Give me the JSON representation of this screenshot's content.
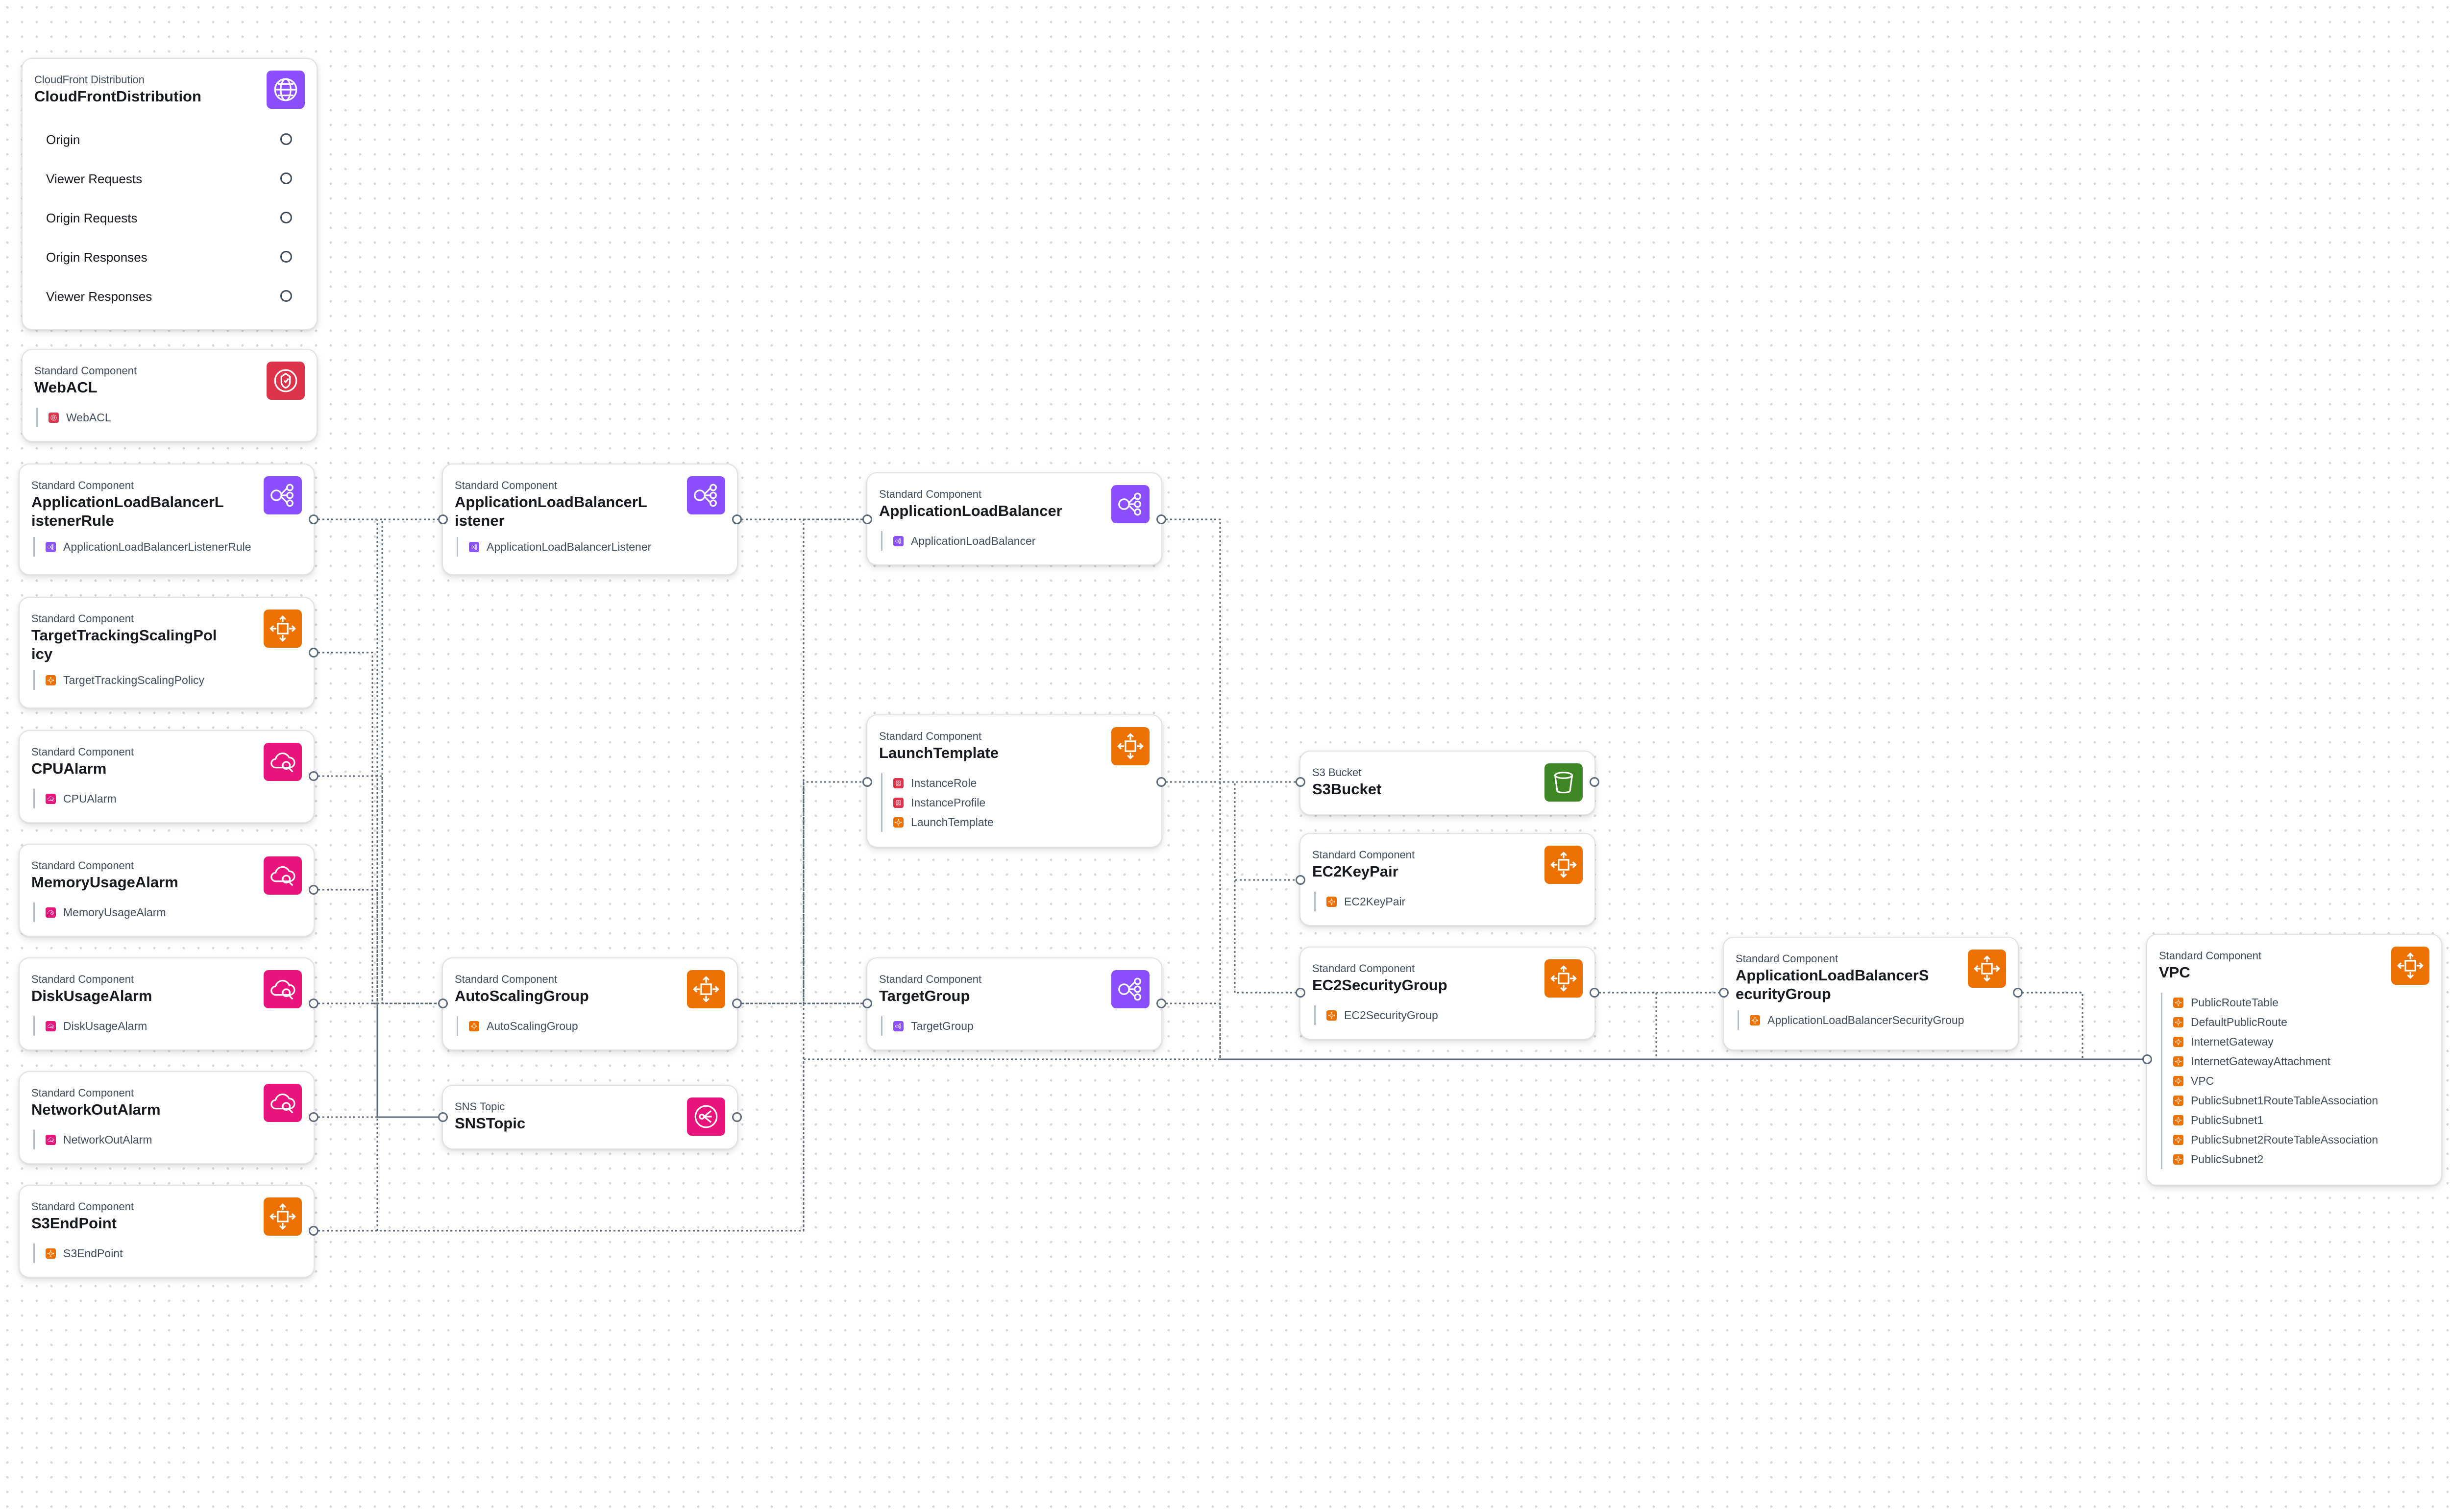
{
  "colors": {
    "purple": "#8c4fff",
    "orange": "#ed7100",
    "pink": "#e7157b",
    "red": "#dd344c",
    "green": "#3f8624",
    "wire": "#5f6b7a"
  },
  "cloudfront": {
    "type": "CloudFront Distribution",
    "title": "CloudFrontDistribution",
    "icon": "cloudfront-icon",
    "rows": [
      "Origin",
      "Viewer Requests",
      "Origin Requests",
      "Origin Responses",
      "Viewer Responses"
    ]
  },
  "nodes": [
    {
      "id": "webacl",
      "type": "Standard Component",
      "title": "WebACL",
      "icon": "waf-icon",
      "color": "red",
      "children": [
        {
          "label": "WebACL",
          "color": "red",
          "icon": "waf-icon"
        }
      ]
    },
    {
      "id": "listener-rule",
      "type": "Standard Component",
      "title": "ApplicationLoadBalancerL\nistenerRule",
      "icon": "load-balancer-icon",
      "color": "purple",
      "children": [
        {
          "label": "ApplicationLoadBalancerListenerRule",
          "color": "purple",
          "icon": "load-balancer-icon"
        }
      ]
    },
    {
      "id": "scaling-policy",
      "type": "Standard Component",
      "title": "TargetTrackingScalingPol\nicy",
      "icon": "autoscaling-icon",
      "color": "orange",
      "children": [
        {
          "label": "TargetTrackingScalingPolicy",
          "color": "orange",
          "icon": "autoscaling-icon"
        }
      ]
    },
    {
      "id": "cpu-alarm",
      "type": "Standard Component",
      "title": "CPUAlarm",
      "icon": "cloudwatch-alarm-icon",
      "color": "pink",
      "children": [
        {
          "label": "CPUAlarm",
          "color": "pink",
          "icon": "cloudwatch-alarm-icon"
        }
      ]
    },
    {
      "id": "memory-alarm",
      "type": "Standard Component",
      "title": "MemoryUsageAlarm",
      "icon": "cloudwatch-alarm-icon",
      "color": "pink",
      "children": [
        {
          "label": "MemoryUsageAlarm",
          "color": "pink",
          "icon": "cloudwatch-alarm-icon"
        }
      ]
    },
    {
      "id": "disk-alarm",
      "type": "Standard Component",
      "title": "DiskUsageAlarm",
      "icon": "cloudwatch-alarm-icon",
      "color": "pink",
      "children": [
        {
          "label": "DiskUsageAlarm",
          "color": "pink",
          "icon": "cloudwatch-alarm-icon"
        }
      ]
    },
    {
      "id": "network-alarm",
      "type": "Standard Component",
      "title": "NetworkOutAlarm",
      "icon": "cloudwatch-alarm-icon",
      "color": "pink",
      "children": [
        {
          "label": "NetworkOutAlarm",
          "color": "pink",
          "icon": "cloudwatch-alarm-icon"
        }
      ]
    },
    {
      "id": "s3-endpoint",
      "type": "Standard Component",
      "title": "S3EndPoint",
      "icon": "autoscaling-icon",
      "color": "orange",
      "children": [
        {
          "label": "S3EndPoint",
          "color": "orange",
          "icon": "autoscaling-icon"
        }
      ]
    },
    {
      "id": "listener",
      "type": "Standard Component",
      "title": "ApplicationLoadBalancerL\nistener",
      "icon": "load-balancer-icon",
      "color": "purple",
      "children": [
        {
          "label": "ApplicationLoadBalancerListener",
          "color": "purple",
          "icon": "load-balancer-icon"
        }
      ]
    },
    {
      "id": "asg",
      "type": "Standard Component",
      "title": "AutoScalingGroup",
      "icon": "autoscaling-icon",
      "color": "orange",
      "children": [
        {
          "label": "AutoScalingGroup",
          "color": "orange",
          "icon": "autoscaling-icon"
        }
      ]
    },
    {
      "id": "sns",
      "type": "SNS Topic",
      "title": "SNSTopic",
      "icon": "sns-topic-icon",
      "color": "pink",
      "children": []
    },
    {
      "id": "alb",
      "type": "Standard Component",
      "title": "ApplicationLoadBalancer",
      "icon": "load-balancer-icon",
      "color": "purple",
      "children": [
        {
          "label": "ApplicationLoadBalancer",
          "color": "purple",
          "icon": "load-balancer-icon"
        }
      ]
    },
    {
      "id": "launch-template",
      "type": "Standard Component",
      "title": "LaunchTemplate",
      "icon": "autoscaling-icon",
      "color": "orange",
      "children": [
        {
          "label": "InstanceRole",
          "color": "red",
          "icon": "iam-icon"
        },
        {
          "label": "InstanceProfile",
          "color": "red",
          "icon": "iam-icon"
        },
        {
          "label": "LaunchTemplate",
          "color": "orange",
          "icon": "autoscaling-icon"
        }
      ]
    },
    {
      "id": "target-group",
      "type": "Standard Component",
      "title": "TargetGroup",
      "icon": "load-balancer-icon",
      "color": "purple",
      "children": [
        {
          "label": "TargetGroup",
          "color": "purple",
          "icon": "load-balancer-icon"
        }
      ]
    },
    {
      "id": "s3-bucket",
      "type": "S3 Bucket",
      "title": "S3Bucket",
      "icon": "s3-bucket-icon",
      "color": "green",
      "children": []
    },
    {
      "id": "keypair",
      "type": "Standard Component",
      "title": "EC2KeyPair",
      "icon": "autoscaling-icon",
      "color": "orange",
      "children": [
        {
          "label": "EC2KeyPair",
          "color": "orange",
          "icon": "autoscaling-icon"
        }
      ]
    },
    {
      "id": "ec2-sg",
      "type": "Standard Component",
      "title": "EC2SecurityGroup",
      "icon": "autoscaling-icon",
      "color": "orange",
      "children": [
        {
          "label": "EC2SecurityGroup",
          "color": "orange",
          "icon": "autoscaling-icon"
        }
      ]
    },
    {
      "id": "alb-sg",
      "type": "Standard Component",
      "title": "ApplicationLoadBalancerS\necurityGroup",
      "icon": "autoscaling-icon",
      "color": "orange",
      "children": [
        {
          "label": "ApplicationLoadBalancerSecurityGroup",
          "color": "orange",
          "icon": "autoscaling-icon"
        }
      ]
    },
    {
      "id": "vpc",
      "type": "Standard Component",
      "title": "VPC",
      "icon": "autoscaling-icon",
      "color": "orange",
      "children": [
        {
          "label": "PublicRouteTable",
          "color": "orange",
          "icon": "autoscaling-icon"
        },
        {
          "label": "DefaultPublicRoute",
          "color": "orange",
          "icon": "autoscaling-icon"
        },
        {
          "label": "InternetGateway",
          "color": "orange",
          "icon": "autoscaling-icon"
        },
        {
          "label": "InternetGatewayAttachment",
          "color": "orange",
          "icon": "autoscaling-icon"
        },
        {
          "label": "VPC",
          "color": "orange",
          "icon": "autoscaling-icon"
        },
        {
          "label": "PublicSubnet1RouteTableAssociation",
          "color": "orange",
          "icon": "autoscaling-icon"
        },
        {
          "label": "PublicSubnet1",
          "color": "orange",
          "icon": "autoscaling-icon"
        },
        {
          "label": "PublicSubnet2RouteTableAssociation",
          "color": "orange",
          "icon": "autoscaling-icon"
        },
        {
          "label": "PublicSubnet2",
          "color": "orange",
          "icon": "autoscaling-icon"
        }
      ]
    }
  ],
  "edges": [
    {
      "from": "listener-rule",
      "to": "listener"
    },
    {
      "from": "listener",
      "to": "alb"
    },
    {
      "from": "alb",
      "to": "vpc"
    },
    {
      "from": "scaling-policy",
      "to": "asg"
    },
    {
      "from": "cpu-alarm",
      "to": "sns"
    },
    {
      "from": "memory-alarm",
      "to": "sns"
    },
    {
      "from": "disk-alarm",
      "to": "sns"
    },
    {
      "from": "network-alarm",
      "to": "sns"
    },
    {
      "from": "cpu-alarm",
      "to": "asg"
    },
    {
      "from": "s3-endpoint",
      "to": "vpc"
    },
    {
      "from": "listener-rule",
      "to": "target-group"
    },
    {
      "from": "asg",
      "to": "launch-template"
    },
    {
      "from": "asg",
      "to": "target-group"
    },
    {
      "from": "launch-template",
      "to": "s3-bucket"
    },
    {
      "from": "launch-template",
      "to": "keypair"
    },
    {
      "from": "launch-template",
      "to": "ec2-sg"
    },
    {
      "from": "target-group",
      "to": "vpc"
    },
    {
      "from": "ec2-sg",
      "to": "alb-sg"
    },
    {
      "from": "ec2-sg",
      "to": "vpc"
    },
    {
      "from": "alb-sg",
      "to": "vpc"
    }
  ]
}
